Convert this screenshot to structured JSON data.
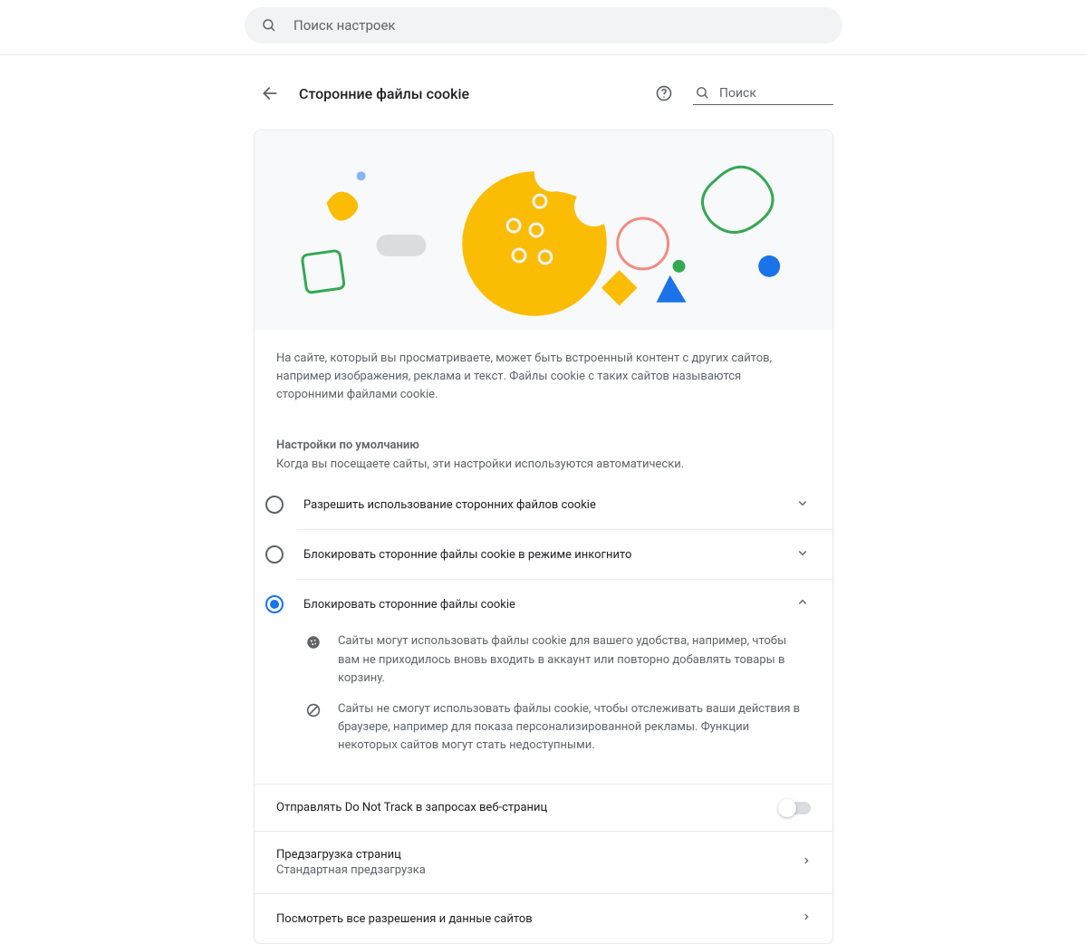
{
  "topSearch": {
    "placeholder": "Поиск настроек"
  },
  "header": {
    "title": "Сторонние файлы cookie",
    "search_placeholder": "Поиск"
  },
  "intro": "На сайте, который вы просматриваете, может быть встроенный контент с других сайтов, например изображения, реклама и текст. Файлы cookie с таких сайтов называются сторонними файлами cookie.",
  "defaults": {
    "label": "Настройки по умолчанию",
    "sub": "Когда вы посещаете сайты, эти настройки используются автоматически."
  },
  "options": [
    {
      "label": "Разрешить использование сторонних файлов cookie",
      "selected": false,
      "expanded": false
    },
    {
      "label": "Блокировать сторонние файлы cookie в режиме инкогнито",
      "selected": false,
      "expanded": false
    },
    {
      "label": "Блокировать сторонние файлы cookie",
      "selected": true,
      "expanded": true
    }
  ],
  "expandedDetails": [
    "Сайты могут использовать файлы cookie для вашего удобства, например, чтобы вам не приходилось вновь входить в аккаунт или повторно добавлять товары в корзину.",
    "Сайты не смогут использовать файлы cookie, чтобы отслеживать ваши действия в браузере, например для показа персонализированной рекламы. Функции некоторых сайтов могут стать недоступными."
  ],
  "rows": {
    "dnt": {
      "label": "Отправлять Do Not Track в запросах веб-страниц",
      "enabled": false
    },
    "preload": {
      "label": "Предзагрузка страниц",
      "sub": "Стандартная предзагрузка"
    },
    "all_perms": {
      "label": "Посмотреть все разрешения и данные сайтов"
    }
  }
}
